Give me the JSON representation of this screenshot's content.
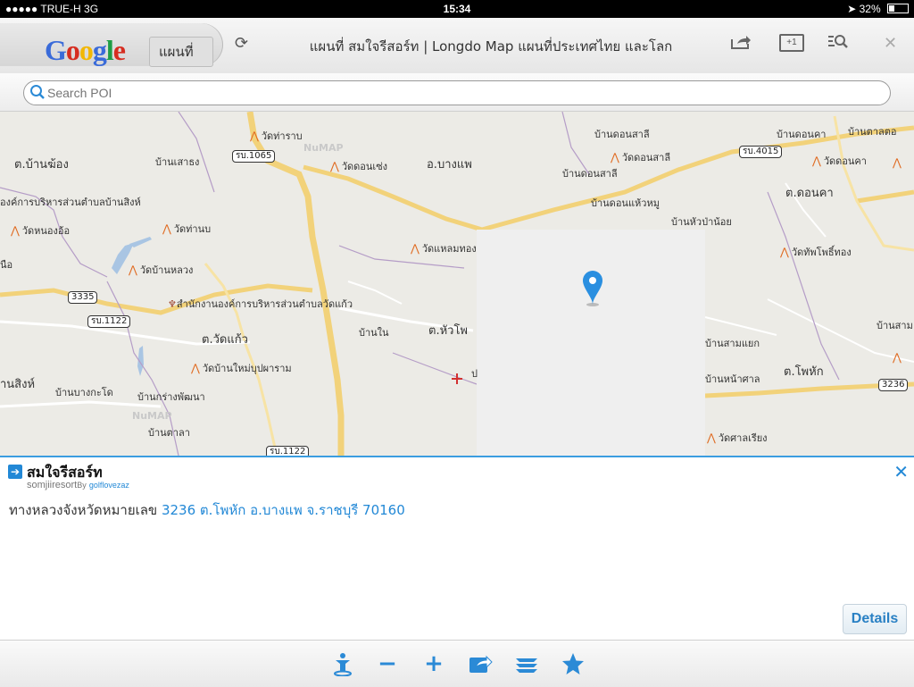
{
  "status": {
    "carrier": "●●●●● TRUE-H  3G",
    "time": "15:34",
    "battery": "32%",
    "battery_level": 0.32
  },
  "browser": {
    "tab_title": "แผนที่",
    "page_title": "แผนที่ สมใจรีสอร์ท | Longdo Map แผนที่ประเทศไทย และโลก",
    "plus_label": "+1",
    "google_letters": [
      "G",
      "o",
      "o",
      "g",
      "l",
      "e"
    ]
  },
  "search": {
    "placeholder": "Search POI"
  },
  "map": {
    "labels": [
      {
        "text": "วัดท่าราบ",
        "temple": true
      },
      {
        "text": "ต.บ้านฆ้อง",
        "big": true
      },
      {
        "text": "บ้านเสาธง"
      },
      {
        "text": "วัดดอนเซ่ง",
        "temple": true
      },
      {
        "text": "อ.บางแพ",
        "big": true
      },
      {
        "text": "บ้านดอนสาลี"
      },
      {
        "text": "วัดดอนสาลี",
        "temple": true
      },
      {
        "text": "บ้านดอนสาลี"
      },
      {
        "text": "บ้านดอนคา"
      },
      {
        "text": "บ้านตาลตอ"
      },
      {
        "text": "วัดดอนคา",
        "temple": true
      },
      {
        "text": "องค์การบริหารส่วนตำบลบ้านสิงห์"
      },
      {
        "text": "ต.ดอนคา",
        "big": true
      },
      {
        "text": "บ้านดอนแห้วหมู"
      },
      {
        "text": "บ้านหัวป่าน้อย"
      },
      {
        "text": "วัดหนองอ้อ",
        "temple": true
      },
      {
        "text": "วัดท่านบ",
        "temple": true
      },
      {
        "text": "วัดแหลมทอง",
        "temple": true
      },
      {
        "text": "วัดทัพโพธิ์ทอง",
        "temple": true
      },
      {
        "text": "นือ"
      },
      {
        "text": "วัดบ้านหลวง",
        "temple": true
      },
      {
        "text": "สำนักงานองค์การบริหารส่วนตำบลวัดแก้ว"
      },
      {
        "text": "บ้านสาม"
      },
      {
        "text": "บ้านใน"
      },
      {
        "text": "ต.หัวโพ",
        "big": true
      },
      {
        "text": "ต.วัดแก้ว",
        "big": true
      },
      {
        "text": "บ้านสามแยก"
      },
      {
        "text": "วัดบ้านใหม่บุปผาราม",
        "temple": true
      },
      {
        "text": "ต.โพหัก",
        "big": true
      },
      {
        "text": "านสิงห์",
        "big": true
      },
      {
        "text": "บ้านบางกะโด"
      },
      {
        "text": "บ้านกร่างพัฒนา"
      },
      {
        "text": "บ้านหน้าศาล"
      },
      {
        "text": "บ้านตาลา"
      },
      {
        "text": "วัดศาลเรียง",
        "temple": true
      },
      {
        "text": "ป"
      }
    ],
    "roads": [
      "รบ.1065",
      "รบ.4015",
      "3335",
      "รบ.1122",
      "3236",
      "รบ.1122"
    ],
    "watermarks": [
      "NuMAP",
      "NuMAP"
    ]
  },
  "panel": {
    "name": "สมใจรีสอร์ท",
    "sub_name": "somjiiresort",
    "by": "By",
    "user": "golflovezaz",
    "address_prefix": "ทางหลวงจังหวัดหมายเลข",
    "address_link": "3236 ต.โพหัก อ.บางแพ จ.ราชบุรี 70160",
    "details_label": "Details",
    "close_glyph": "✕",
    "arrow_glyph": "➔"
  },
  "toolbar": {
    "minus": "−",
    "plus": "+"
  }
}
